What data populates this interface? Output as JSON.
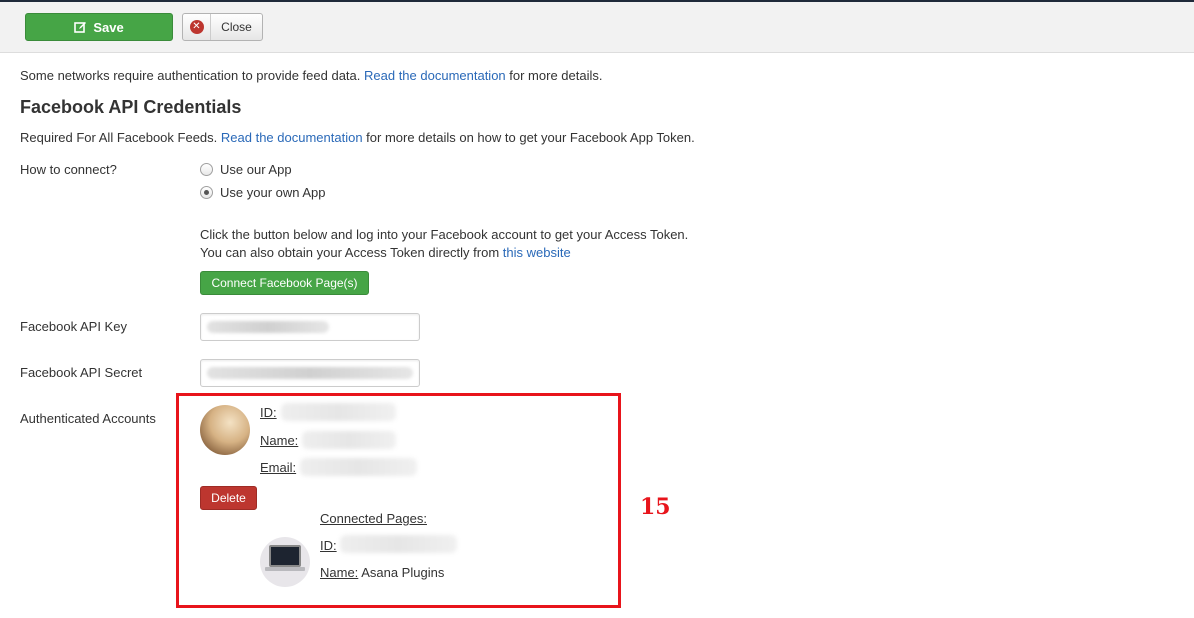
{
  "toolbar": {
    "save_label": "Save",
    "close_label": "Close"
  },
  "intro": {
    "text_before": "Some networks require authentication to provide feed data. ",
    "link": "Read the documentation",
    "text_after": " for more details."
  },
  "section": {
    "title": "Facebook API Credentials",
    "required_before": "Required For All Facebook Feeds. ",
    "required_link": "Read the documentation",
    "required_after": " for more details on how to get your Facebook App Token."
  },
  "connect": {
    "label": "How to connect?",
    "options": [
      {
        "label": "Use our App",
        "checked": false
      },
      {
        "label": "Use your own App",
        "checked": true
      }
    ],
    "instructions_line1": "Click the button below and log into your Facebook account to get your Access Token.",
    "instructions_line2_before": "You can also obtain your Access Token directly from ",
    "instructions_link": "this website",
    "button_label": "Connect Facebook Page(s)"
  },
  "fields": {
    "api_key_label": "Facebook API Key",
    "api_secret_label": "Facebook API Secret"
  },
  "accounts": {
    "label": "Authenticated Accounts",
    "id_label": "ID:",
    "name_label": "Name:",
    "email_label": "Email:",
    "delete_label": "Delete",
    "connected_pages_label": "Connected Pages:",
    "page_id_label": "ID:",
    "page_name_label": "Name:",
    "page_name_value": "Asana Plugins"
  },
  "annotation": "15",
  "colors": {
    "green": "#46a546",
    "red_button": "#bd362f",
    "highlight_red": "#e8141b",
    "link": "#2a69b8"
  }
}
